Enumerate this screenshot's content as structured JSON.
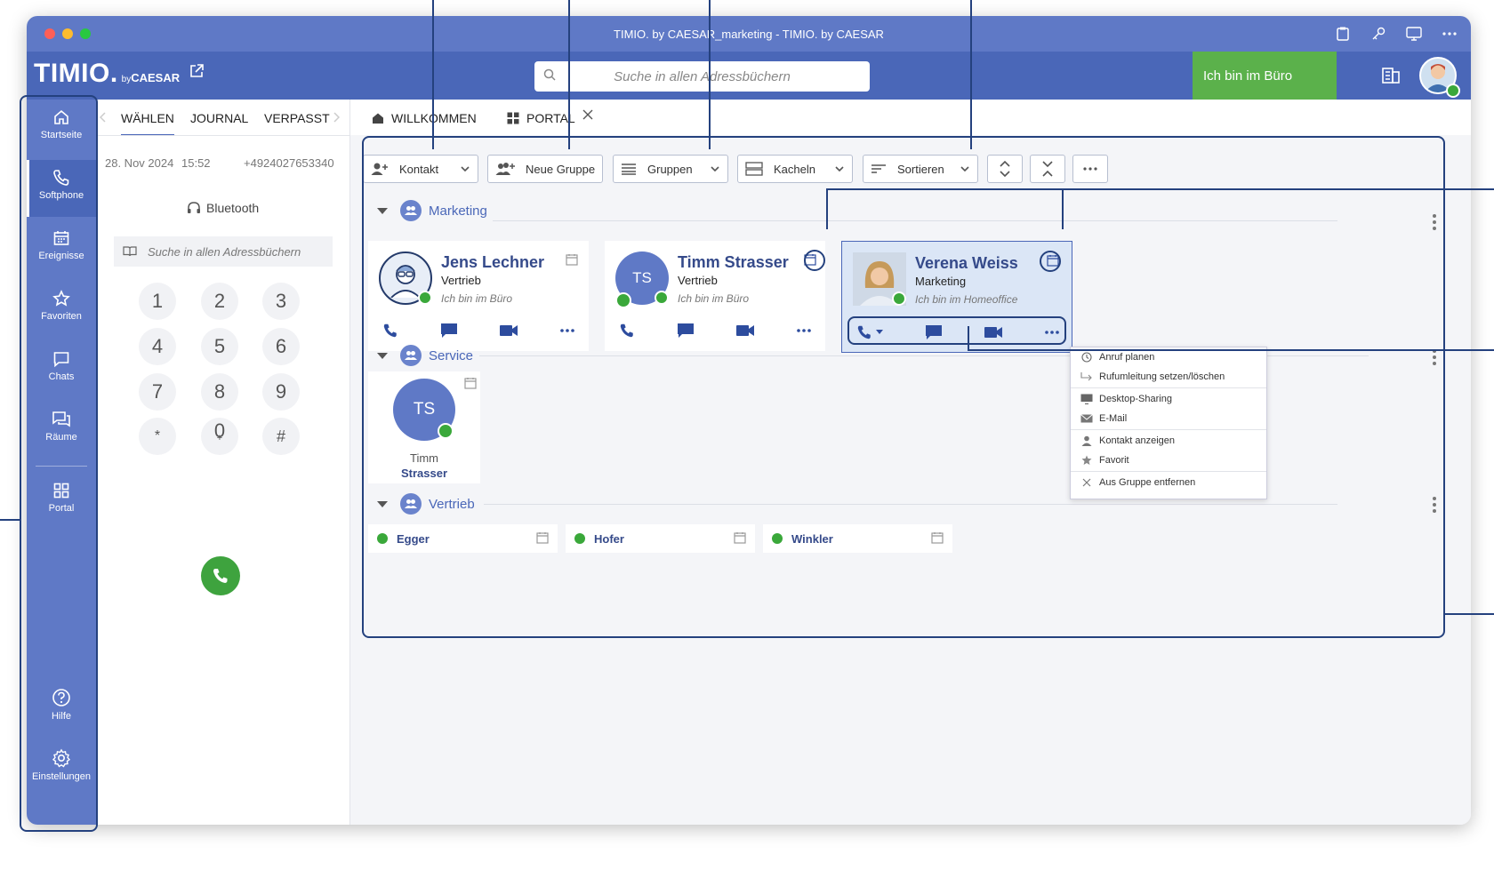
{
  "window": {
    "title": "TIMIO. by CAESAR_marketing - TIMIO. by CAESAR"
  },
  "header": {
    "logo_main": "TIMIO.",
    "logo_by": "by",
    "logo_sub": "CAESAR",
    "search_placeholder": "Suche in allen Adressbüchern",
    "status_label": "Ich bin im Büro"
  },
  "sidebar": {
    "items": [
      {
        "label": "Startseite",
        "icon": "home-icon"
      },
      {
        "label": "Softphone",
        "icon": "phone-icon"
      },
      {
        "label": "Ereignisse",
        "icon": "calendar-icon"
      },
      {
        "label": "Favoriten",
        "icon": "star-icon"
      },
      {
        "label": "Chats",
        "icon": "chat-icon"
      },
      {
        "label": "Räume",
        "icon": "rooms-icon"
      },
      {
        "label": "Portal",
        "icon": "grid-icon"
      },
      {
        "label": "Hilfe",
        "icon": "help-icon"
      },
      {
        "label": "Einstellungen",
        "icon": "gear-icon"
      }
    ]
  },
  "softphone": {
    "tabs": [
      "WÄHLEN",
      "JOURNAL",
      "VERPASST"
    ],
    "date": "28. Nov 2024",
    "time": "15:52",
    "number": "+4924027653340",
    "audio_device": "Bluetooth",
    "search_placeholder": "Suche in allen Adressbüchern",
    "keys": [
      "1",
      "2",
      "3",
      "4",
      "5",
      "6",
      "7",
      "8",
      "9",
      "*",
      "0",
      "#"
    ],
    "zero_sub": "+"
  },
  "main": {
    "tabs": [
      {
        "label": "WILLKOMMEN",
        "icon": "home-icon"
      },
      {
        "label": "PORTAL",
        "icon": "grid-icon"
      }
    ],
    "toolbar": {
      "contact": "Kontakt",
      "new_group": "Neue Gruppe",
      "groups": "Gruppen",
      "view": "Kacheln",
      "sort": "Sortieren"
    },
    "groups": [
      {
        "name": "Marketing",
        "cards": [
          {
            "name": "Jens Lechner",
            "dept": "Vertrieb",
            "status": "Ich bin im Büro"
          },
          {
            "name": "Timm Strasser",
            "initials": "TS",
            "dept": "Vertrieb",
            "status": "Ich bin im Büro"
          },
          {
            "name": "Verena Weiss",
            "dept": "Marketing",
            "status": "Ich bin im Homeoffice"
          }
        ]
      },
      {
        "name": "Service",
        "tiles": [
          {
            "initials": "TS",
            "first": "Timm",
            "last": "Strasser"
          }
        ]
      },
      {
        "name": "Vertrieb",
        "rows": [
          {
            "name": "Egger"
          },
          {
            "name": "Hofer"
          },
          {
            "name": "Winkler"
          }
        ]
      }
    ],
    "context_menu": [
      "Anruf planen",
      "Rufumleitung setzen/löschen",
      "Desktop-Sharing",
      "E-Mail",
      "Kontakt anzeigen",
      "Favorit",
      "Aus Gruppe entfernen"
    ]
  },
  "colors": {
    "titlebar": "#5f79c6",
    "header": "#4a67b8",
    "status_green": "#5bb14b",
    "accent_dark": "#24417e"
  }
}
